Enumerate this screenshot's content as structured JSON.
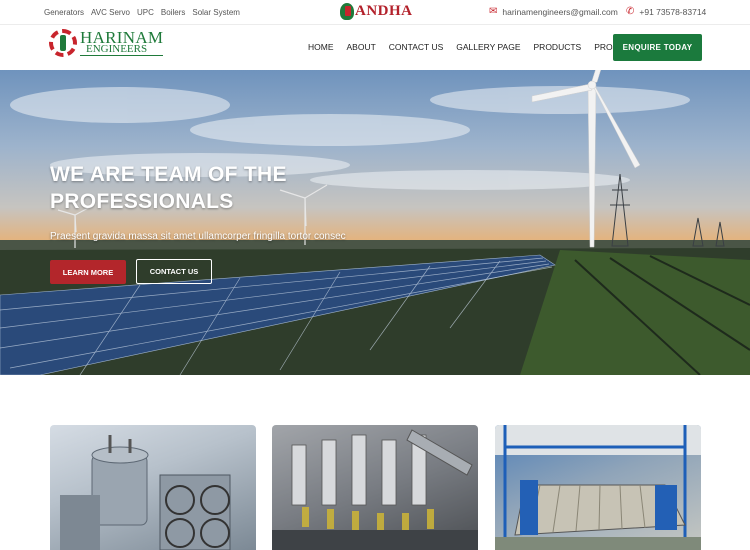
{
  "topbar": {
    "links": [
      "Generators",
      "AVC Servo",
      "UPC",
      "Boilers",
      "Solar System"
    ],
    "brand": "ANDHA",
    "email": "harinamengineers@gmail.com",
    "phone": "+91 73578-83714",
    "email_icon": "envelope-icon",
    "phone_icon": "phone-icon"
  },
  "logo": {
    "line1": "HARINAM",
    "line2": "ENGINEERS"
  },
  "nav": {
    "items": [
      "HOME",
      "ABOUT",
      "CONTACT US",
      "GALLERY PAGE",
      "PRODUCTS",
      "PROJECTS"
    ],
    "cta": "ENQUIRE TODAY"
  },
  "hero": {
    "title": "WE ARE TEAM OF THE PROFESSIONALS",
    "subtitle": "Praesent gravida massa sit amet ullamcorper fringilla tortor consec",
    "learn_more": "LEARN MORE",
    "contact_us": "CONTACT US"
  },
  "colors": {
    "accent_green": "#1b7a3d",
    "accent_red": "#b3262b"
  }
}
